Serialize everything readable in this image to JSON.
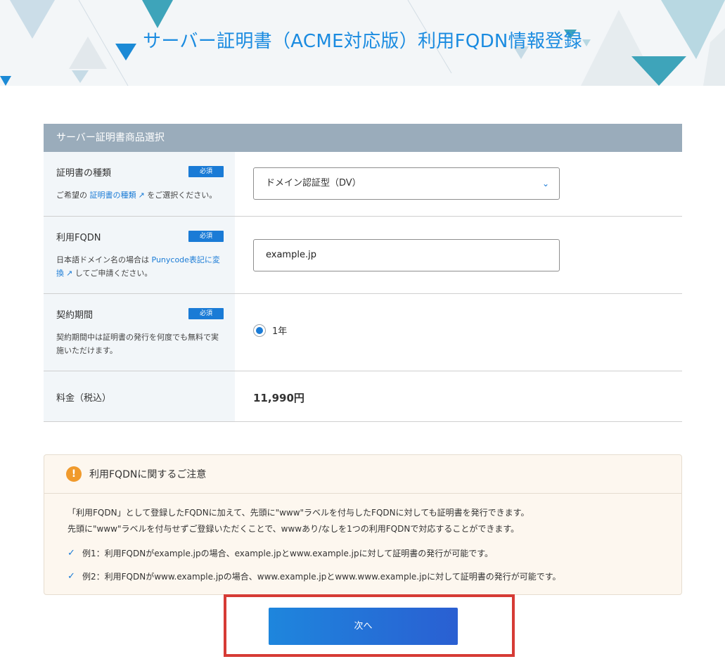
{
  "page": {
    "title": "サーバー証明書（ACME対応版）利用FQDN情報登録"
  },
  "form": {
    "section_title": "サーバー証明書商品選択",
    "required_label": "必須",
    "cert_type": {
      "label": "証明書の種類",
      "desc_prefix": "ご希望の",
      "desc_link": "証明書の種類",
      "desc_suffix": "をご選択ください。",
      "selected": "ドメイン認証型（DV）"
    },
    "fqdn": {
      "label": "利用FQDN",
      "desc_prefix": "日本語ドメイン名の場合は",
      "desc_link": "Punycode表記に変換",
      "desc_suffix": "してご申請ください。",
      "value": "example.jp"
    },
    "period": {
      "label": "契約期間",
      "desc": "契約期間中は証明書の発行を何度でも無料で実施いただけます。",
      "option": "1年"
    },
    "price": {
      "label": "料金（税込）",
      "value": "11,990円"
    }
  },
  "notice": {
    "title": "利用FQDNに関するご注意",
    "line1": "「利用FQDN」として登録したFQDNに加えて、先頭に\"www\"ラベルを付与したFQDNに対しても証明書を発行できます。",
    "line2": "先頭に\"www\"ラベルを付与せずご登録いただくことで、wwwあり/なしを1つの利用FQDNで対応することができます。",
    "example1": "例1：利用FQDNがexample.jpの場合、example.jpとwww.example.jpに対して証明書の発行が可能です。",
    "example2": "例2：利用FQDNがwww.example.jpの場合、www.example.jpとwww.www.example.jpに対して証明書の発行が可能です。"
  },
  "buttons": {
    "next": "次へ"
  },
  "colors": {
    "accent": "#1a7bd6",
    "title": "#1a8be0",
    "section_header": "#9aacbb",
    "highlight_frame": "#d63b35",
    "notice_bg": "#fdf7ef",
    "warn_icon": "#f09a2c"
  },
  "icons": {
    "external_link": "external-link-icon",
    "dropdown": "chevron-down-icon",
    "warning": "exclamation-icon",
    "check": "check-icon"
  }
}
